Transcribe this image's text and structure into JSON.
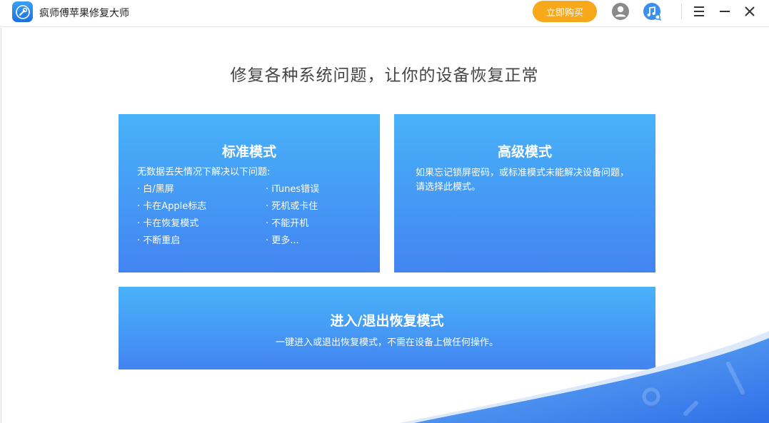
{
  "app": {
    "title": "疯师傅苹果修复大师",
    "buy_label": "立即购买",
    "icons": [
      "wrench-logo-icon",
      "user-icon",
      "music-icon",
      "menu-icon",
      "minimize-icon",
      "close-icon"
    ]
  },
  "main": {
    "headline": "修复各种系统问题，让你的设备恢复正常",
    "standard": {
      "title": "标准模式",
      "subtitle": "无数据丢失情况下解决以下问题:",
      "issues": [
        "· 白/黑屏",
        "· iTunes错误",
        "· 卡在Apple标志",
        "· 死机或卡住",
        "· 卡在恢复模式",
        "· 不能开机",
        "· 不断重启",
        "· 更多..."
      ]
    },
    "advanced": {
      "title": "高级模式",
      "description": "如果忘记锁屏密码，或标准模式未能解决设备问题，请选择此模式。"
    },
    "recovery": {
      "title": "进入/退出恢复模式",
      "description": "一键进入或退出恢复模式，不需在设备上做任何操作。"
    }
  },
  "colors": {
    "accent": "#f7a81b",
    "card_top": "#48b2f8",
    "card_bottom": "#4384f2"
  }
}
